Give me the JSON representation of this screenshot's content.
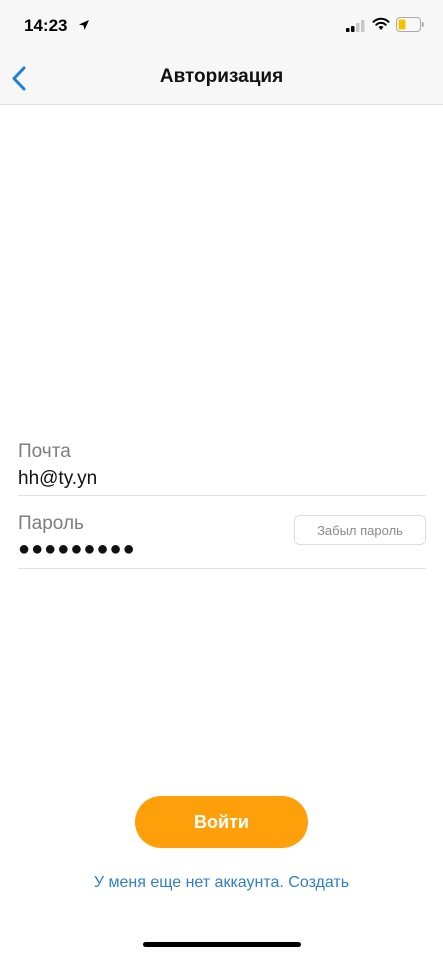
{
  "status_bar": {
    "time": "14:23",
    "icons": [
      "location-arrow-icon",
      "signal-bars-icon",
      "wifi-icon",
      "battery-low-icon"
    ],
    "battery_color": "#f5c400"
  },
  "nav": {
    "title": "Авторизация",
    "back_icon": "chevron-left-icon",
    "accent_color": "#1f7fd6"
  },
  "form": {
    "email": {
      "label": "Почта",
      "value": "hh@ty.yn"
    },
    "password": {
      "label": "Пароль",
      "value": "●●●●●●●●●",
      "forgot_label": "Забыл пароль"
    }
  },
  "actions": {
    "login_label": "Войти",
    "login_color": "#ff9f0a",
    "register_text": "У меня еще нет аккаунта. Создать",
    "link_color": "#2f7fc6"
  }
}
